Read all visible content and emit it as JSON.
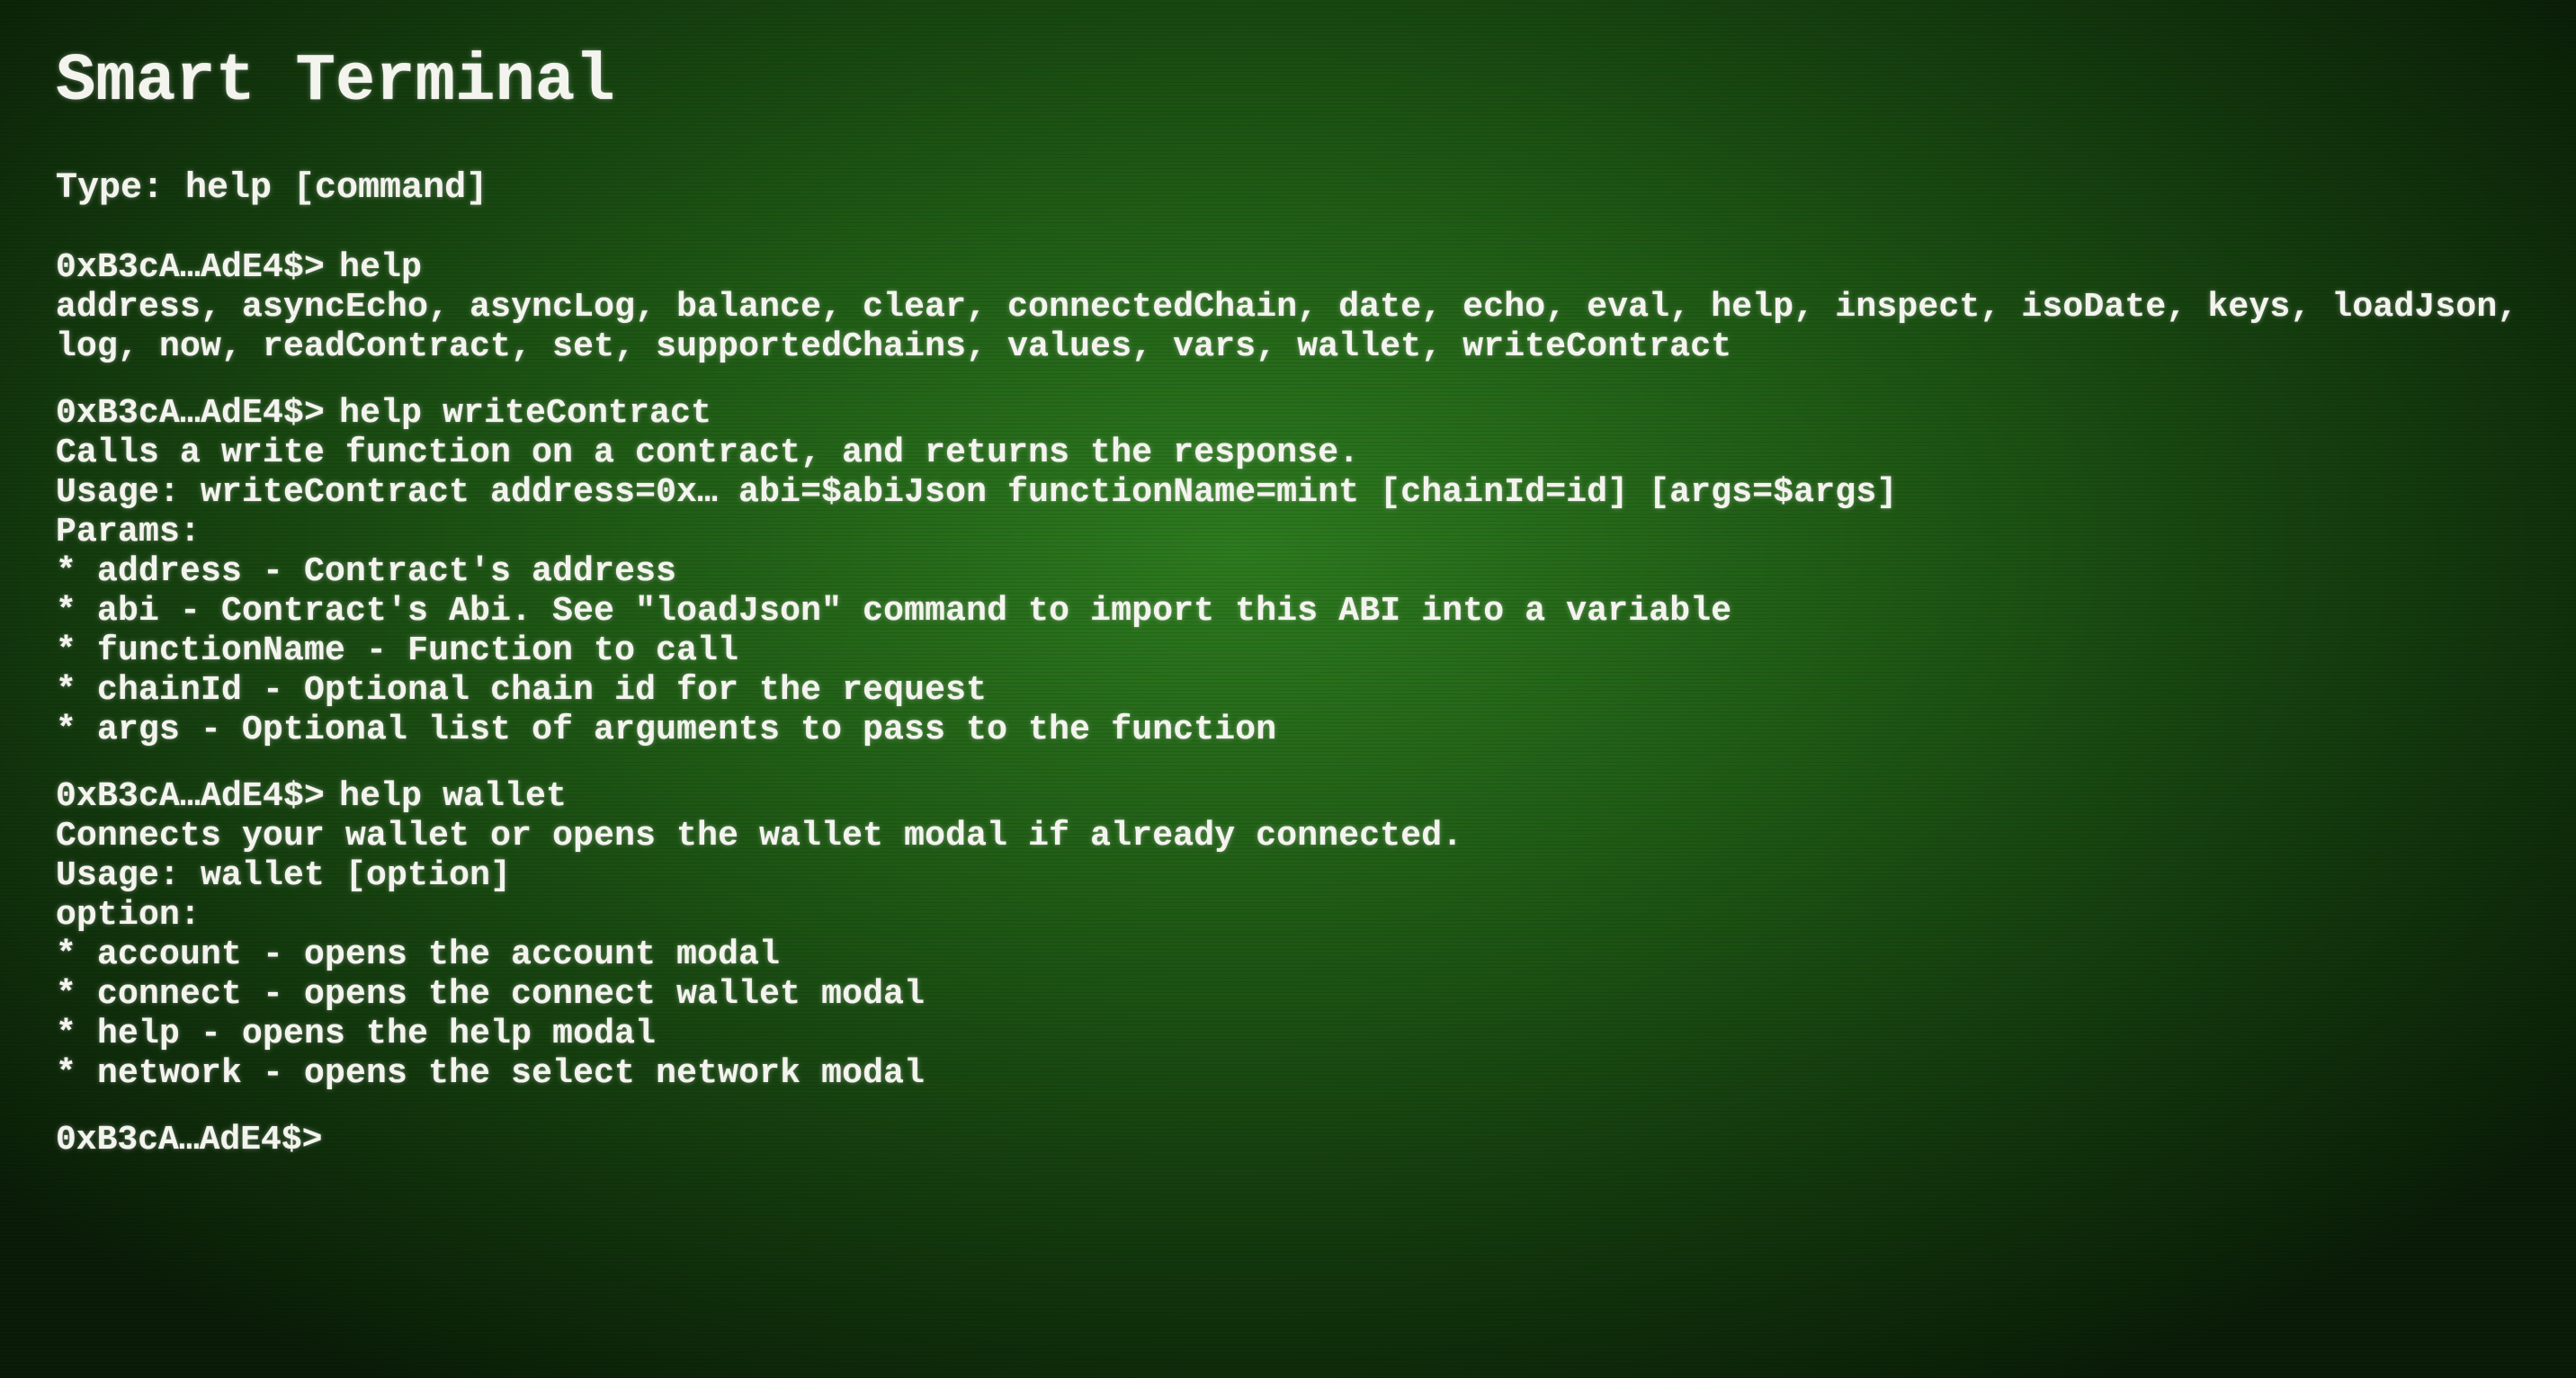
{
  "app": {
    "title": "Smart Terminal",
    "hint": "Type: help [command]"
  },
  "prompt": "0xB3cA…AdE4$>",
  "history": [
    {
      "command": "help",
      "output": [
        "address, asyncEcho, asyncLog, balance, clear, connectedChain, date, echo, eval, help, inspect, isoDate, keys, loadJson,",
        "log, now, readContract, set, supportedChains, values, vars, wallet, writeContract"
      ]
    },
    {
      "command": "help writeContract",
      "output": [
        "Calls a write function on a contract, and returns the response.",
        "Usage: writeContract address=0x… abi=$abiJson functionName=mint [chainId=id] [args=$args]",
        "Params:",
        "* address - Contract's address",
        "* abi - Contract's Abi. See \"loadJson\" command to import this ABI into a variable",
        "* functionName - Function to call",
        "* chainId - Optional chain id for the request",
        "* args - Optional list of arguments to pass to the function"
      ]
    },
    {
      "command": "help wallet",
      "output": [
        "Connects your wallet or opens the wallet modal if already connected.",
        "Usage: wallet [option]",
        "option:",
        "* account - opens the account modal",
        "* connect - opens the connect wallet modal",
        "* help - opens the help modal",
        "* network - opens the select network modal"
      ]
    }
  ],
  "input": {
    "value": ""
  },
  "colors": {
    "background_center": "#2d7a1f",
    "background_edge": "#0a1d07",
    "text": "#f4f4ee"
  }
}
